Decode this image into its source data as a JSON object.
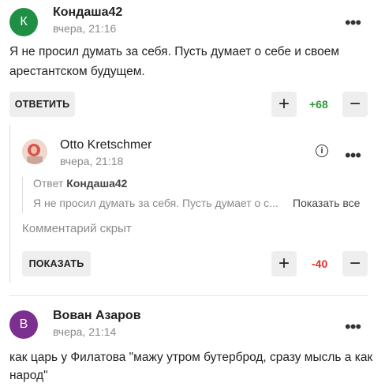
{
  "comments": [
    {
      "avatar_letter": "К",
      "avatar_color": "#1f8f44",
      "author": "Кондаша42",
      "time": "вчера, 21:16",
      "text_line1": "Я не просил думать за себя. Пусть думает о себе и своем",
      "text_line2": "арестантском будущем.",
      "reply_label": "ОТВЕТИТЬ",
      "score": "+68",
      "score_color": "#2e9b3a"
    }
  ],
  "reply": {
    "author": "Otto Kretschmer",
    "time": "вчера, 21:18",
    "quote_prefix": "Ответ",
    "quote_author": "Кондаша42",
    "quote_text": "Я не просил думать за себя. Пусть думает о с...",
    "show_all": "Показать все",
    "hidden_text": "Комментарий скрыт",
    "show_label": "ПОКАЗАТЬ",
    "score": "-40",
    "score_color": "#e0302a"
  },
  "comment2": {
    "avatar_letter": "В",
    "avatar_color": "#7b2f8f",
    "author": "Вован Азаров",
    "time": "вчера, 21:14",
    "text_line1": "как царь у Филатова \"мажу утром бутерброд, сразу мысль а как",
    "text_line2": "народ\""
  },
  "icons": {
    "plus": "+",
    "minus": "−",
    "more": "•••",
    "info": "i"
  }
}
